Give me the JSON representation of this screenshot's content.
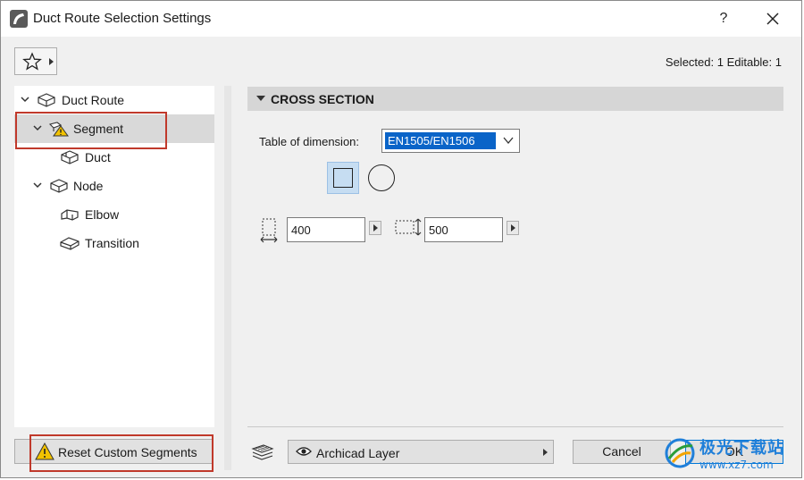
{
  "window": {
    "title": "Duct Route Selection Settings",
    "help_label": "?"
  },
  "header": {
    "selected_info": "Selected: 1 Editable: 1"
  },
  "tree": {
    "items": [
      {
        "label": "Duct Route",
        "icon": "duct-route-icon"
      },
      {
        "label": "Segment",
        "icon": "segment-warning-icon"
      },
      {
        "label": "Duct",
        "icon": "duct-icon"
      },
      {
        "label": "Node",
        "icon": "node-icon"
      },
      {
        "label": "Elbow",
        "icon": "elbow-icon"
      },
      {
        "label": "Transition",
        "icon": "transition-icon"
      }
    ]
  },
  "reset_button": {
    "label": "Reset Custom Segments"
  },
  "cross_section": {
    "title": "CROSS SECTION",
    "table_label": "Table of dimension:",
    "table_value": "EN1505/EN1506",
    "width_value": "400",
    "height_value": "500",
    "shape_selected": "rectangular"
  },
  "footer": {
    "layer_label": "Archicad Layer",
    "cancel_label": "Cancel",
    "ok_label": "OK"
  },
  "watermark": {
    "brand": "极光下载站",
    "url": "www.xz7.com"
  },
  "colors": {
    "selection_blue": "#0a64c8",
    "shape_highlight": "#c6ddf2",
    "annotation_red": "#c0392b",
    "warning_yellow": "#f2c200"
  }
}
